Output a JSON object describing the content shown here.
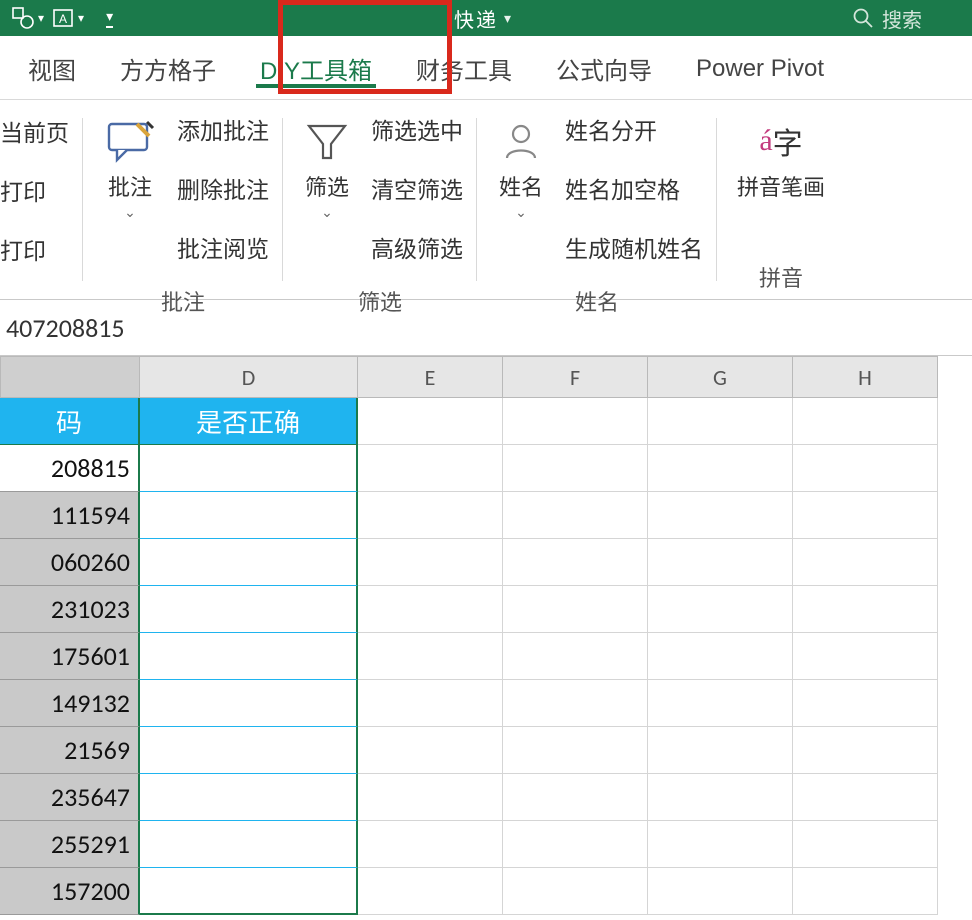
{
  "title_bar": {
    "doc_name": "快递",
    "search_placeholder": "搜索"
  },
  "tabs": {
    "items": [
      {
        "label": "视图"
      },
      {
        "label": "方方格子"
      },
      {
        "label": "DIY工具箱",
        "active": true,
        "highlighted": true
      },
      {
        "label": "财务工具"
      },
      {
        "label": "公式向导"
      },
      {
        "label": "Power Pivot"
      }
    ]
  },
  "ribbon": {
    "group0": {
      "items": [
        "当前页",
        "打印",
        "打印"
      ]
    },
    "group_comment": {
      "big_label": "批注",
      "items": [
        "添加批注",
        "删除批注",
        "批注阅览"
      ],
      "label": "批注"
    },
    "group_filter": {
      "big_label": "筛选",
      "items": [
        "筛选选中",
        "清空筛选",
        "高级筛选"
      ],
      "label": "筛选"
    },
    "group_name": {
      "big_label": "姓名",
      "items": [
        "姓名分开",
        "姓名加空格",
        "生成随机姓名"
      ],
      "label": "姓名"
    },
    "group_pinyin": {
      "big_label": "拼音笔画",
      "label": "拼音"
    }
  },
  "formula_bar": {
    "value": "407208815"
  },
  "columns": [
    "",
    "D",
    "E",
    "F",
    "G",
    "H"
  ],
  "grid": {
    "header_c": "码",
    "header_d": "是否正确",
    "rows": [
      {
        "c": "208815"
      },
      {
        "c": "111594"
      },
      {
        "c": "060260"
      },
      {
        "c": "231023"
      },
      {
        "c": "175601"
      },
      {
        "c": "149132"
      },
      {
        "c": "21569"
      },
      {
        "c": "235647"
      },
      {
        "c": "255291"
      },
      {
        "c": "157200"
      }
    ]
  }
}
